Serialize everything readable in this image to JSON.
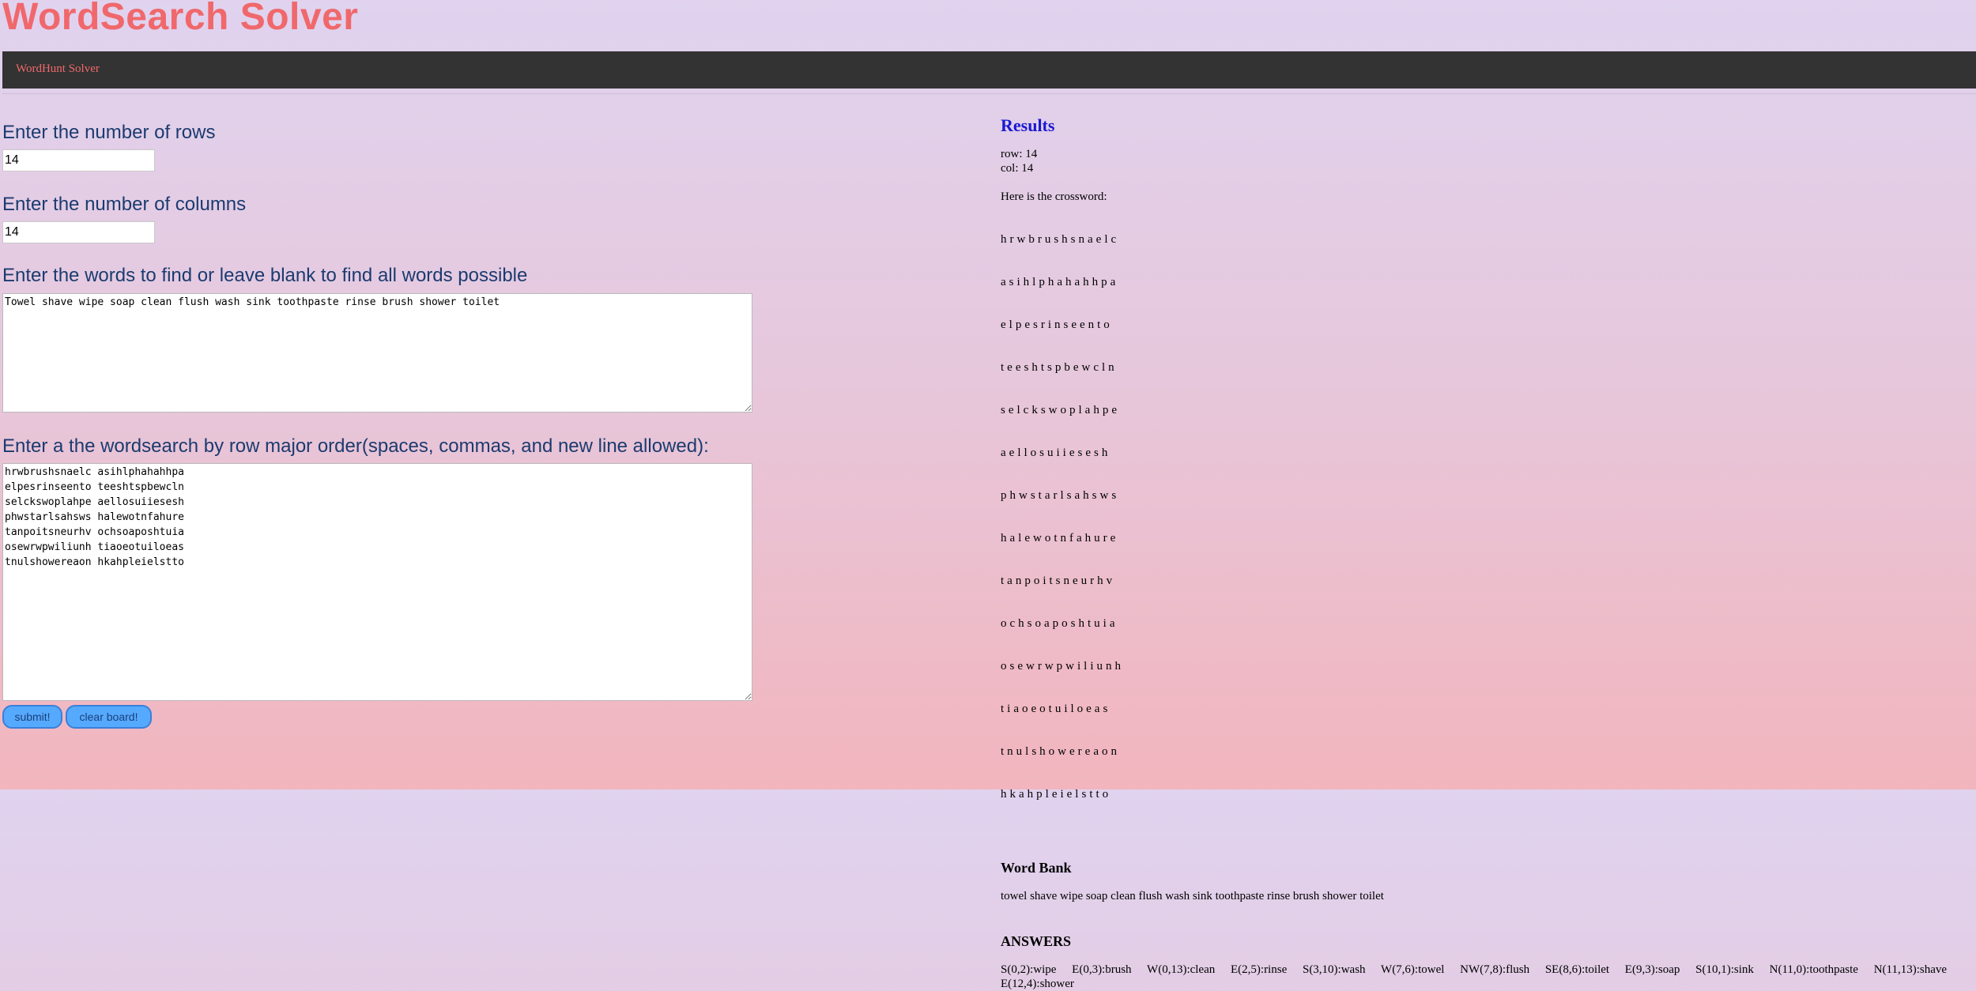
{
  "title": "WordSearch Solver",
  "nav": {
    "link": "WordHunt Solver"
  },
  "form": {
    "rows_label": "Enter the number of rows",
    "rows_value": "14",
    "cols_label": "Enter the number of columns",
    "cols_value": "14",
    "words_label": "Enter the words to find or leave blank to find all words possible",
    "words_value": "Towel shave wipe soap clean flush wash sink toothpaste rinse brush shower toilet",
    "grid_label": "Enter a the wordsearch by row major order(spaces, commas, and new line allowed):",
    "grid_value": "hrwbrushsnaelc asihlphahahhpa\nelpesrinseento teeshtspbewcln\nselckswoplahpe aellosuiiesesh\nphwstarlsahsws halewotnfahure\ntanpoitsneurhv ochsoaposhtuia\nosewrwpwiliunh tiaoeotuiloeas\ntnulshowereaon hkahpleielstto",
    "submit_label": "submit!",
    "clear_label": "clear board!"
  },
  "results": {
    "heading": "Results",
    "rows_line": "row: 14",
    "cols_line": "col: 14",
    "crossword_intro": "Here is the crossword:",
    "grid_rows": [
      "hrwbrushsnaelc",
      "asihlphahahhpa",
      "elpesrinseento",
      "teeshtspbewcln",
      "selckswoplahpe",
      "aellosuiiesesh",
      "phwstarlsahsws",
      "halewotnfahure",
      "tanpoitsneurhv",
      "ochsoaposhtuia",
      "osewrwpwiliunh",
      "tiaoeotuiloeas",
      "tnulshowereaon",
      "hkahpleielstto"
    ],
    "word_bank_heading": "Word Bank",
    "word_bank": "towel shave wipe soap clean flush wash sink toothpaste rinse brush shower toilet",
    "answers_heading": "ANSWERS",
    "answers_line1": "S(0,2):wipe E(0,3):brush W(0,13):clean E(2,5):rinse S(3,10):wash W(7,6):towel NW(7,8):flush SE(8,6):toilet E(9,3):soap S(10,1):sink N(11,0):toothpaste N(11,13):shave",
    "answers_line2": "E(12,4):shower"
  },
  "colors": {
    "title": "#f0686c",
    "navbar_bg": "#333333",
    "label_text": "#1b3b6f",
    "results_heading": "#1919d2",
    "button_bg": "#55aaff"
  }
}
